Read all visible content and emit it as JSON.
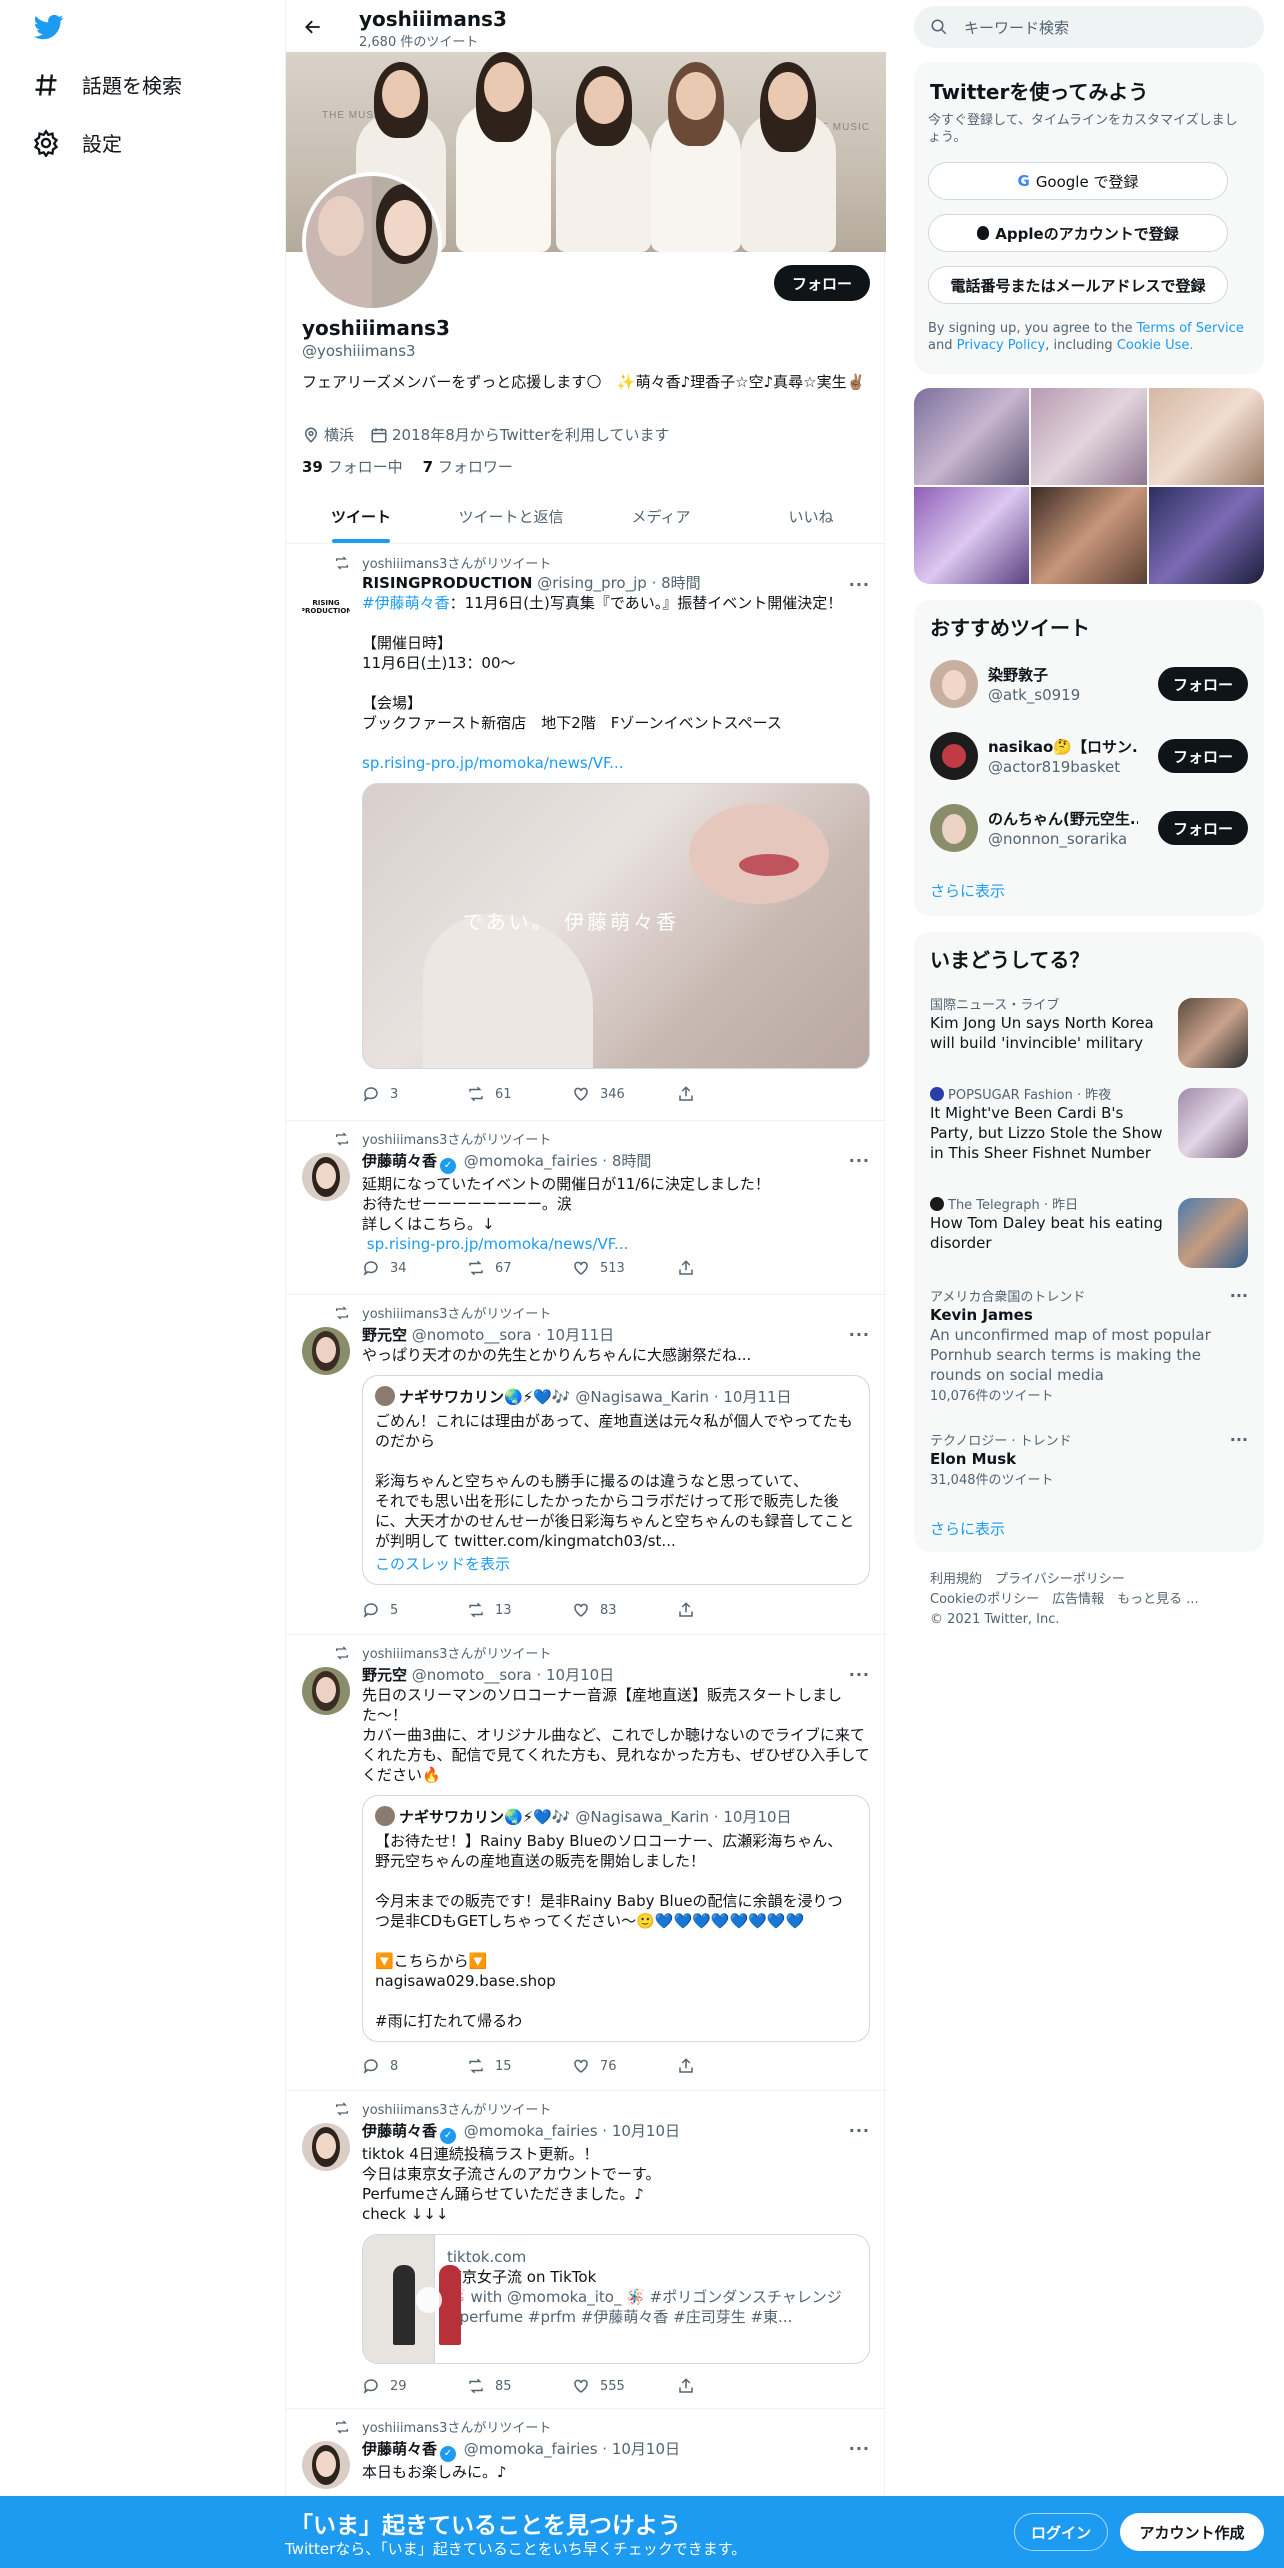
{
  "nav": {
    "explore": "話題を検索",
    "settings": "設定"
  },
  "header": {
    "name": "yoshiiimans3",
    "tweet_count": "2,680 件のツイート"
  },
  "banner": {
    "logo_text": "THE MUSIC DAY"
  },
  "profile": {
    "follow_label": "フォロー",
    "name": "yoshiiimans3",
    "handle": "@yoshiiimans3",
    "bio": "フェアリーズメンバーをずっと応援します🌕　✨萌々香♪理香子☆空♪真尋☆実生✌🏽",
    "location": "横浜",
    "joined": "2018年8月からTwitterを利用しています",
    "following_count": "39",
    "following_label": " フォロー中",
    "followers_count": "7",
    "followers_label": " フォロワー"
  },
  "tabs": [
    "ツイート",
    "ツイートと返信",
    "メディア",
    "いいね"
  ],
  "tweets": [
    {
      "retweet_by": "yoshiiimans3さんがリツイート",
      "name": "RISINGPRODUCTION",
      "handle": "@rising_pro_jp",
      "time": "· 8時間",
      "hashtag": "#伊藤萌々香",
      "text": "：11月6日(土)写真集『であい。』振替イベント開催決定！\n\n【開催日時】\n11月6日(土)13：00～\n\n【会場】\nブックファースト新宿店　地下2階　Fゾーンイベントスペース\n\n",
      "link": "sp.rising-pro.jp/momoka/news/VF...",
      "image_caption": "であい。 伊藤萌々香",
      "replies": "3",
      "retweets": "61",
      "likes": "346"
    },
    {
      "retweet_by": "yoshiiimans3さんがリツイート",
      "name": "伊藤萌々香",
      "handle": "@momoka_fairies",
      "time": "· 8時間",
      "text": "延期になっていたイベントの開催日が11/6に決定しました！\nお待たせーーーーーーーー。涙\n詳しくはこちら。↓",
      "link": " sp.rising-pro.jp/momoka/news/VF...",
      "replies": "34",
      "retweets": "67",
      "likes": "513"
    },
    {
      "retweet_by": "yoshiiimans3さんがリツイート",
      "name": "野元空",
      "handle": "@nomoto__sora",
      "time": "· 10月11日",
      "text": "やっぱり天才のかの先生とかりんちゃんに大感謝祭だね...",
      "quote": {
        "name": "ナギサワカリン🌏⚡💙🎶",
        "handle": "@Nagisawa_Karin",
        "time": "· 10月11日",
        "text": "ごめん！これには理由があって、産地直送は元々私が個人でやってたものだから\n\n彩海ちゃんと空ちゃんのも勝手に撮るのは違うなと思っていて、\nそれでも思い出を形にしたかったからコラボだけって形で販売した後に、大天才かのせんせーが後日彩海ちゃんと空ちゃんのも録音してことが判明して twitter.com/kingmatch03/st...",
        "thread": "このスレッドを表示"
      },
      "replies": "5",
      "retweets": "13",
      "likes": "83"
    },
    {
      "retweet_by": "yoshiiimans3さんがリツイート",
      "name": "野元空",
      "handle": "@nomoto__sora",
      "time": "· 10月10日",
      "text": "先日のスリーマンのソロコーナー音源【産地直送】販売スタートしました〜！\nカバー曲3曲に、オリジナル曲など、これでしか聴けないのでライブに来てくれた方も、配信で見てくれた方も、見れなかった方も、ぜひぜひ入手してください🔥",
      "quote": {
        "name": "ナギサワカリン🌏⚡💙🎶",
        "handle": "@Nagisawa_Karin",
        "time": "· 10月10日",
        "text": "【お待たせ！】Rainy Baby Blueのソロコーナー、広瀬彩海ちゃん、野元空ちゃんの産地直送の販売を開始しました！\n\n今月末までの販売です！是非Rainy Baby Blueの配信に余韻を浸りつつ是非CDもGETしちゃってください〜🙂💙💙💙💙💙💙💙💙\n\n🔽こちらから🔽\nnagisawa029.base.shop\n\n#雨に打たれて帰るわ"
      },
      "replies": "8",
      "retweets": "15",
      "likes": "76"
    },
    {
      "retweet_by": "yoshiiimans3さんがリツイート",
      "name": "伊藤萌々香",
      "handle": "@momoka_fairies",
      "time": "· 10月10日",
      "text": "tiktok 4日連続投稿ラスト更新。！\n今日は東京女子流さんのアカウントでーす。\nPerfumeさん踊らせていただきました。♪\ncheck ↓↓↓",
      "card": {
        "domain": "tiktok.com",
        "title": "東京女子流 on TikTok",
        "desc": "🪅 with @momoka_ito_ 🪅 #ポリゴンダンスチャレンジ #perfume #prfm #伊藤萌々香 #庄司芽生 #東..."
      },
      "replies": "29",
      "retweets": "85",
      "likes": "555"
    },
    {
      "retweet_by": "yoshiiimans3さんがリツイート",
      "name": "伊藤萌々香",
      "handle": "@momoka_fairies",
      "time": "· 10月10日",
      "text": "本日もお楽しみに。♪"
    }
  ],
  "right": {
    "search_placeholder": "キーワード検索",
    "signup": {
      "title": "Twitterを使ってみよう",
      "desc": "今すぐ登録して、タイムラインをカスタマイズしましょう。",
      "google": "Google で登録",
      "apple": "Appleのアカウントで登録",
      "phone": "電話番号またはメールアドレスで登録",
      "terms_prefix": "By signing up, you agree to the ",
      "terms": "Terms of Service",
      "and": " and ",
      "privacy": "Privacy Policy",
      "including": ", including ",
      "cookie": "Cookie Use."
    },
    "recommend": {
      "title": "おすすめツイート",
      "users": [
        {
          "name": "染野敦子",
          "handle": "@atk_s0919",
          "follow": "フォロー"
        },
        {
          "name": "nasikao🤔【ロサン...",
          "handle": "@actor819basket",
          "follow": "フォロー"
        },
        {
          "name": "のんちゃん(野元空生...",
          "handle": "@nonnon_sorarika",
          "follow": "フォロー"
        }
      ],
      "more": "さらに表示"
    },
    "trends": {
      "title": "いまどうしてる？",
      "items": [
        {
          "meta": "国際ニュース・ライブ",
          "title": "Kim Jong Un says North Korea will build 'invincible' military"
        },
        {
          "meta": "POPSUGAR Fashion · 昨夜",
          "title": "It Might've Been Cardi B's Party, but Lizzo Stole the Show in This Sheer Fishnet Number"
        },
        {
          "meta": "The Telegraph · 昨日",
          "title": "How Tom Daley beat his eating disorder"
        },
        {
          "meta": "アメリカ合衆国のトレンド",
          "title": "Kevin James",
          "desc": "An unconfirmed map of most popular Pornhub search terms is making the rounds on social media",
          "count": "10,076件のツイート"
        },
        {
          "meta": "テクノロジー · トレンド",
          "title": "Elon Musk",
          "count": "31,048件のツイート"
        }
      ],
      "more": "さらに表示"
    },
    "footer": {
      "line1": "利用規約　プライバシーポリシー",
      "line2": "Cookieのポリシー　広告情報　もっと見る ...",
      "line3": "© 2021 Twitter, Inc."
    }
  },
  "bottom_bar": {
    "title": "「いま」起きていることを見つけよう",
    "subtitle": "Twitterなら、「いま」起きていることをいち早くチェックできます。",
    "login": "ログイン",
    "signup": "アカウント作成"
  },
  "colors": {
    "accent": "#1d9bf0",
    "text": "#0f1419",
    "muted": "#536471"
  }
}
